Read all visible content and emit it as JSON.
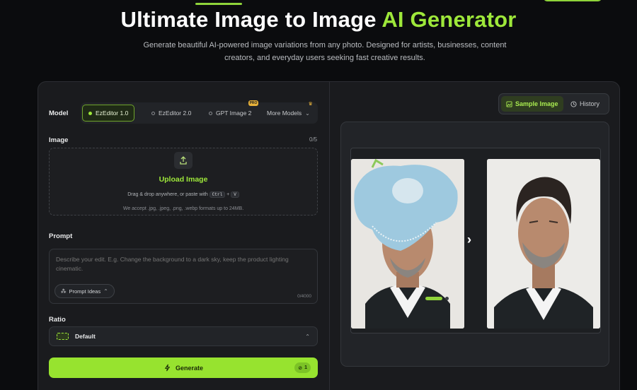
{
  "hero": {
    "title_main": "Ultimate Image to Image ",
    "title_accent": "AI Generator",
    "subtitle_line1": "Generate beautiful AI-powered image variations from any photo. Designed for artists, businesses, content",
    "subtitle_line2": "creators, and everyday users seeking fast creative results."
  },
  "form": {
    "model_label": "Model",
    "models": [
      {
        "label": "EzEditor 1.0",
        "active": true
      },
      {
        "label": "EzEditor 2.0",
        "active": false
      },
      {
        "label": "GPT Image 2",
        "active": false,
        "badge": "PRO"
      },
      {
        "label": "More Models",
        "active": false
      }
    ],
    "image_label": "Image",
    "image_count": "0/5",
    "upload_title": "Upload Image",
    "upload_drag_text": "Drag & drop anywhere, or paste with",
    "kbd_ctrl": "Ctrl",
    "kbd_plus": "+",
    "kbd_v": "V",
    "upload_formats": "We accept .jpg, .jpeg, .png, .webp formats up to 24MB.",
    "prompt_label": "Prompt",
    "prompt_placeholder": "Describe your edit. E.g. Change the background to a dark sky, keep the product lighting cinematic.",
    "prompt_ideas": "Prompt Ideas",
    "char_count": "0/4000",
    "ratio_label": "Ratio",
    "ratio_value": "Default",
    "generate_label": "Generate",
    "generate_cost": "1"
  },
  "preview": {
    "tabs": [
      {
        "label": "Sample Image",
        "active": true,
        "icon": "image-icon"
      },
      {
        "label": "History",
        "active": false,
        "icon": "clock-icon"
      }
    ]
  },
  "colors": {
    "accent": "#9ee83a",
    "background": "#0b0c0e",
    "panel": "#1a1b1e"
  }
}
